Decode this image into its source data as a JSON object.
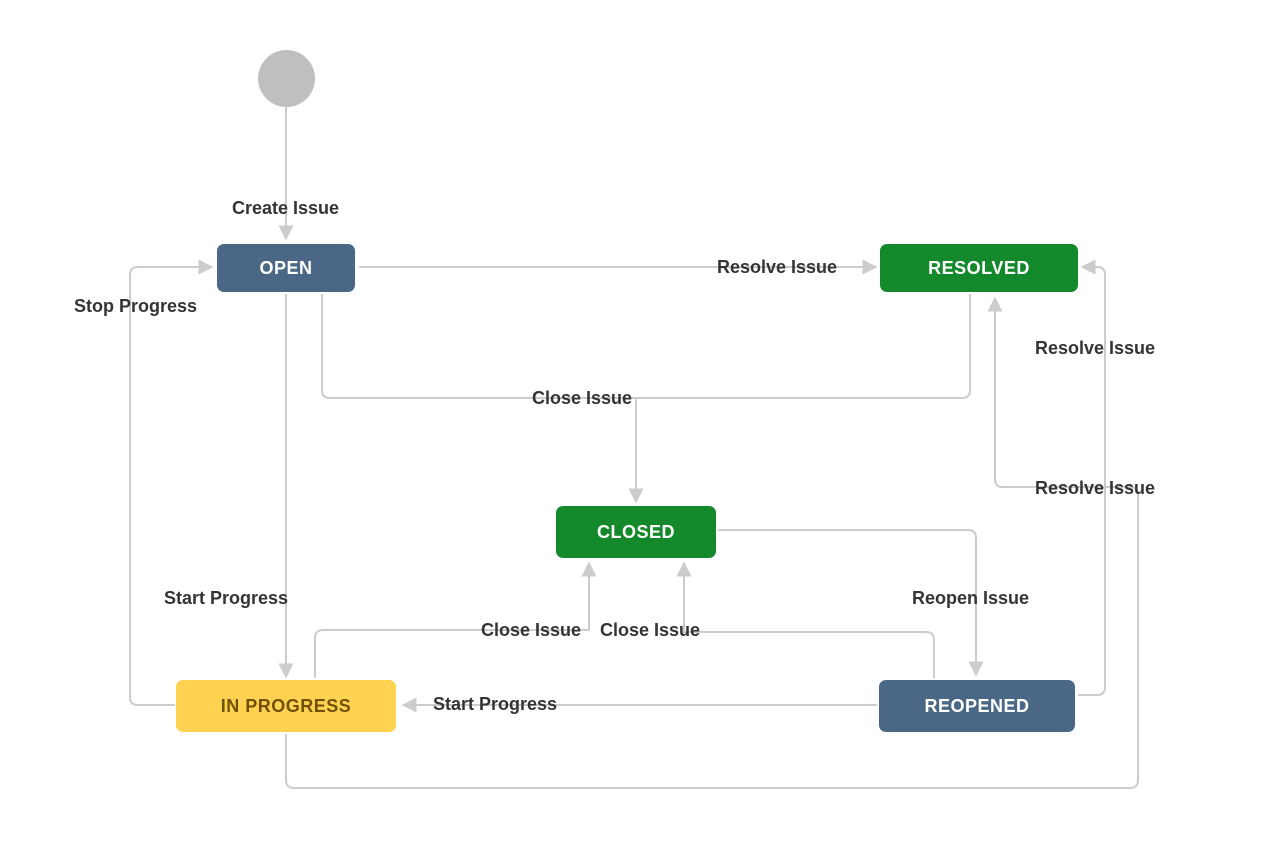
{
  "colors": {
    "blue": "#4a6785",
    "green": "#14892c",
    "yellow": "#ffd351",
    "yellow_text": "#715000",
    "line": "#cccccc",
    "text": "#343434",
    "start": "#bfbfbf"
  },
  "states": {
    "open": {
      "label": "OPEN",
      "color": "blue"
    },
    "resolved": {
      "label": "RESOLVED",
      "color": "green"
    },
    "closed": {
      "label": "CLOSED",
      "color": "green"
    },
    "in_progress": {
      "label": "IN PROGRESS",
      "color": "yellow"
    },
    "reopened": {
      "label": "REOPENED",
      "color": "blue"
    }
  },
  "transitions": {
    "create_issue": {
      "label": "Create Issue",
      "from": "start",
      "to": "open"
    },
    "stop_progress": {
      "label": "Stop Progress",
      "from": "in_progress",
      "to": "open"
    },
    "resolve_issue_open": {
      "label": "Resolve Issue",
      "from": "open",
      "to": "resolved"
    },
    "close_issue_open": {
      "label": "Close Issue",
      "from": "open",
      "to": "closed"
    },
    "close_issue_resolved": {
      "label": "Close Issue",
      "from": "resolved",
      "to": "closed"
    },
    "start_progress_open": {
      "label": "Start Progress",
      "from": "open",
      "to": "in_progress"
    },
    "close_issue_inprogress": {
      "label": "Close Issue",
      "from": "in_progress",
      "to": "closed"
    },
    "close_issue_reopened": {
      "label": "Close Issue",
      "from": "reopened",
      "to": "closed"
    },
    "start_progress_reopened": {
      "label": "Start Progress",
      "from": "reopened",
      "to": "in_progress"
    },
    "reopen_issue": {
      "label": "Reopen Issue",
      "from": "closed",
      "to": "reopened"
    },
    "resolve_issue_reopened": {
      "label": "Resolve Issue",
      "from": "reopened",
      "to": "resolved"
    },
    "resolve_issue_inprog": {
      "label": "Resolve Issue",
      "from": "in_progress",
      "to": "resolved"
    }
  }
}
